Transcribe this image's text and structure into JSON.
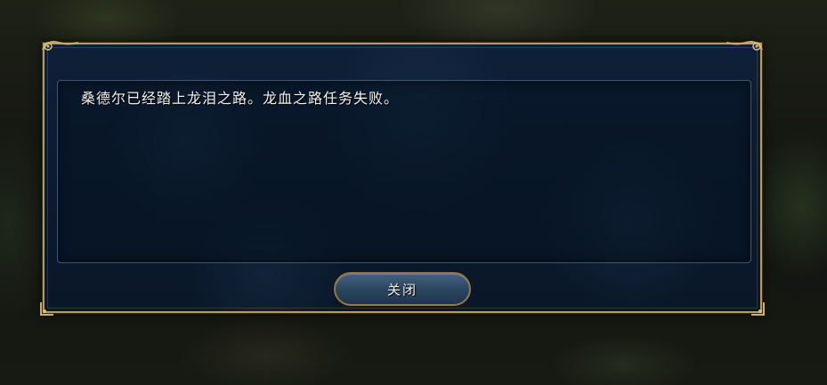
{
  "dialog": {
    "message": "桑德尔已经踏上龙泪之路。龙血之路任务失败。",
    "close_label": "关闭"
  },
  "colors": {
    "frame_gold": "#b59a63",
    "panel_navy": "#0b1a2e",
    "text": "#f2f2ec"
  },
  "icons": {
    "corner_ornament": "gold-scroll-ornament"
  }
}
